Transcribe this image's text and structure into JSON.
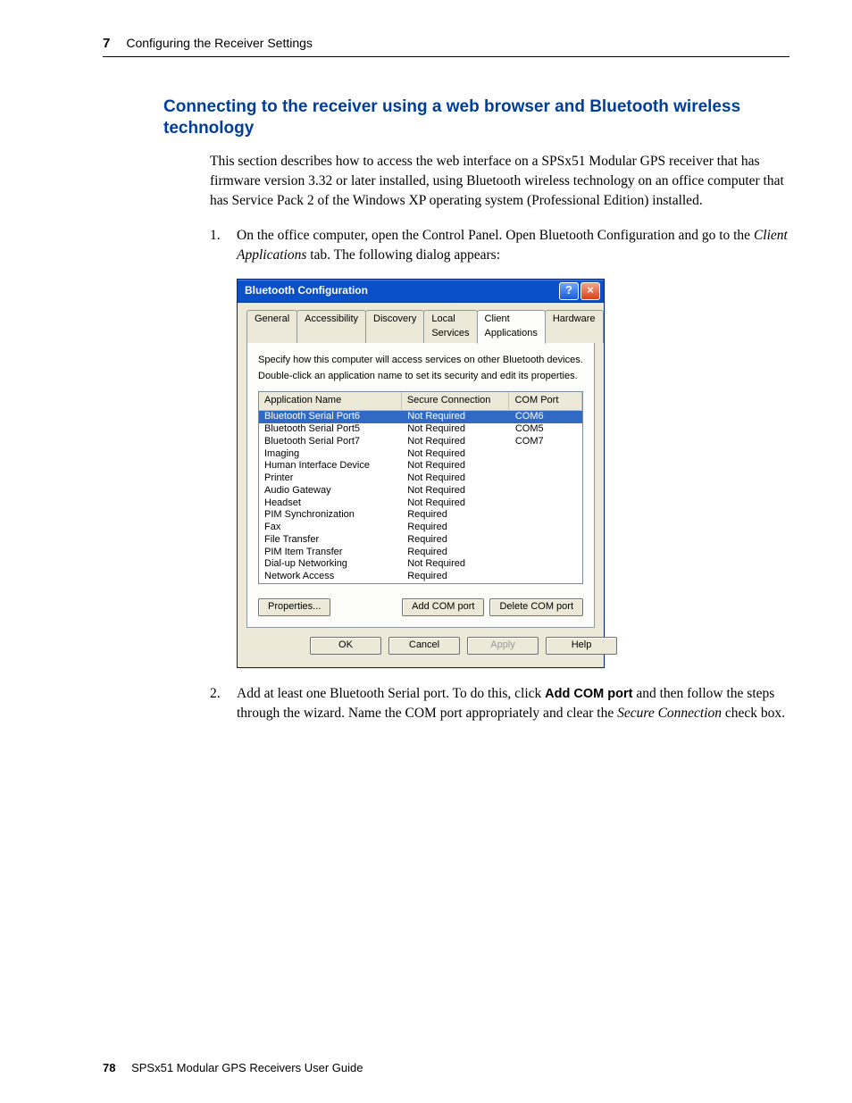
{
  "header": {
    "chapter_num": "7",
    "chapter_title": "Configuring the Receiver Settings"
  },
  "section_title": "Connecting to the receiver using a web browser and Bluetooth wireless technology",
  "intro": "This section describes how to access the web interface on a SPSx51 Modular GPS receiver that has firmware version 3.32 or later installed, using Bluetooth wireless technology on an office computer that has Service Pack 2 of the Windows XP operating system (Professional Edition) installed.",
  "step1_a": "On the office computer, open the Control Panel. Open Bluetooth Configuration and go to the ",
  "step1_b_italic": "Client Applications",
  "step1_c": " tab. The following dialog appears:",
  "step2_a": "Add at least one Bluetooth Serial port. To do this, click ",
  "step2_b_bold": "Add COM port",
  "step2_c": " and then follow the steps through the wizard. Name the COM port appropriately and clear the ",
  "step2_d_italic": "Secure Connection",
  "step2_e": " check box.",
  "dialog": {
    "title": "Bluetooth Configuration",
    "tabs": [
      "General",
      "Accessibility",
      "Discovery",
      "Local Services",
      "Client Applications",
      "Hardware"
    ],
    "active_tab": 4,
    "panel_line1": "Specify how this computer will access services on other Bluetooth devices.",
    "panel_line2": "Double-click an application name to set its security and edit its properties.",
    "columns": [
      "Application Name",
      "Secure Connection",
      "COM Port"
    ],
    "rows": [
      {
        "name": "Bluetooth Serial Port6",
        "sec": "Not Required",
        "com": "COM6",
        "selected": true
      },
      {
        "name": "Bluetooth Serial Port5",
        "sec": "Not Required",
        "com": "COM5"
      },
      {
        "name": "Bluetooth Serial Port7",
        "sec": "Not Required",
        "com": "COM7"
      },
      {
        "name": "Imaging",
        "sec": "Not Required",
        "com": ""
      },
      {
        "name": "Human Interface Device",
        "sec": "Not Required",
        "com": ""
      },
      {
        "name": "Printer",
        "sec": "Not Required",
        "com": ""
      },
      {
        "name": "Audio Gateway",
        "sec": "Not Required",
        "com": ""
      },
      {
        "name": "Headset",
        "sec": "Not Required",
        "com": ""
      },
      {
        "name": "PIM Synchronization",
        "sec": "Required",
        "com": ""
      },
      {
        "name": "Fax",
        "sec": "Required",
        "com": ""
      },
      {
        "name": "File Transfer",
        "sec": "Required",
        "com": ""
      },
      {
        "name": "PIM Item Transfer",
        "sec": "Required",
        "com": ""
      },
      {
        "name": "Dial-up Networking",
        "sec": "Not Required",
        "com": ""
      },
      {
        "name": "Network Access",
        "sec": "Required",
        "com": ""
      }
    ],
    "btn_properties": "Properties...",
    "btn_addcom": "Add COM port",
    "btn_delcom": "Delete COM port",
    "btn_ok": "OK",
    "btn_cancel": "Cancel",
    "btn_apply": "Apply",
    "btn_help": "Help"
  },
  "footer": {
    "page": "78",
    "doc": "SPSx51 Modular GPS Receivers User Guide"
  }
}
